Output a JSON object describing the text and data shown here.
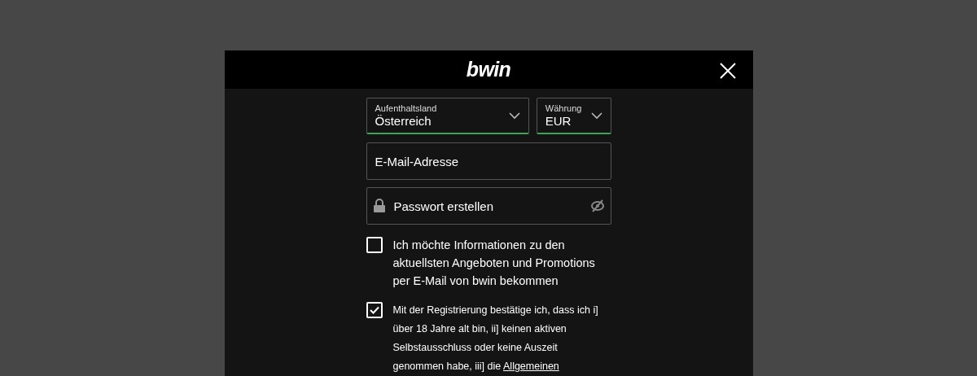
{
  "header": {
    "logo": "bwin"
  },
  "selects": [
    {
      "label": "Aufenthaltsland",
      "value": "Österreich"
    },
    {
      "label": "Währung",
      "value": "EUR"
    }
  ],
  "email": {
    "placeholder": "E-Mail-Adresse"
  },
  "password": {
    "placeholder": "Passwort erstellen"
  },
  "checkboxes": [
    {
      "text": "Ich möchte Informationen zu den aktuellsten Angeboten und Promotions per E-Mail von bwin bekommen",
      "checked": false
    },
    {
      "text": "Mit der Registrierung bestätige ich, dass ich i] über 18 Jahre alt bin, ii] keinen aktiven Selbstausschluss oder keine Auszeit genommen habe, iii] die",
      "link": "Allgemeinen",
      "checked": true
    }
  ]
}
